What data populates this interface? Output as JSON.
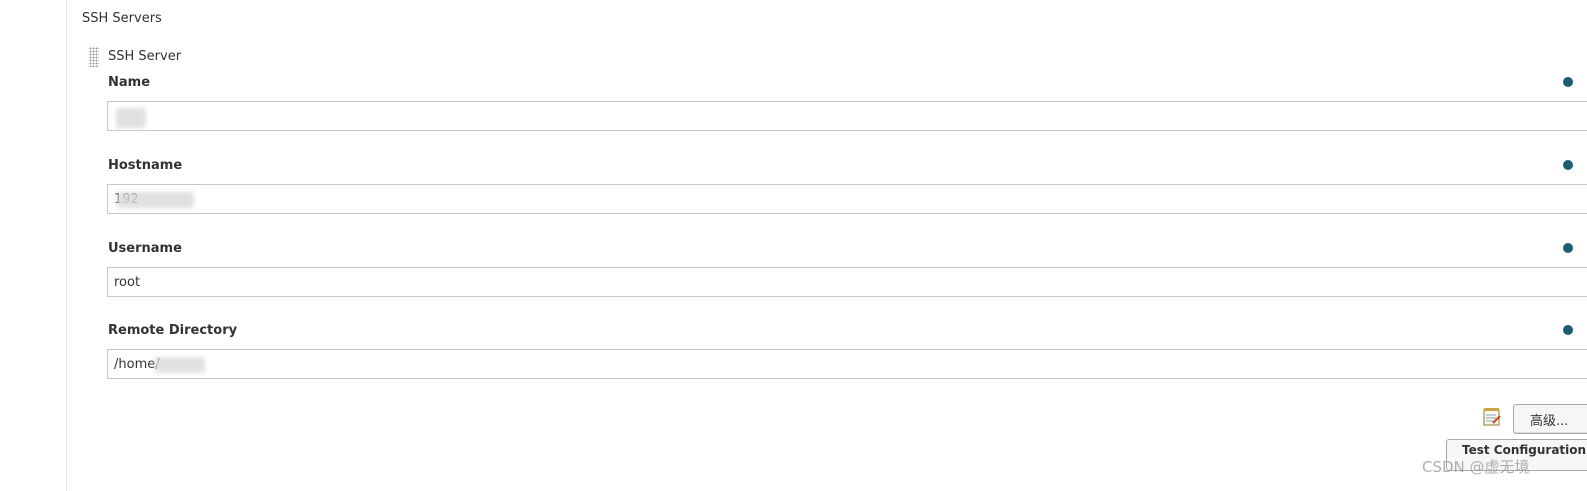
{
  "section": {
    "title": "SSH Servers"
  },
  "server": {
    "header": "SSH Server",
    "fields": {
      "name": {
        "label": "Name",
        "value": ""
      },
      "hostname": {
        "label": "Hostname",
        "value": "192"
      },
      "username": {
        "label": "Username",
        "value": "root"
      },
      "remote_directory": {
        "label": "Remote Directory",
        "value": "/home/"
      }
    }
  },
  "actions": {
    "advanced_label": "高级...",
    "test_label": "Test Configuration"
  },
  "watermark": "CSDN @虚无境",
  "colors": {
    "help_icon": "#1b5e72",
    "input_border": "#c8c8c8"
  },
  "icons": {
    "help": "help-icon",
    "notepad": "notepad-icon",
    "drag": "drag-handle-icon"
  }
}
